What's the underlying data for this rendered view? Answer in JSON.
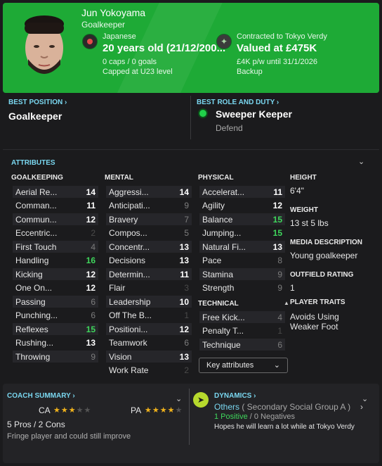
{
  "header": {
    "name": "Jun Yokoyama",
    "position": "Goalkeeper",
    "nationality": "Japanese",
    "age": "20 years old (21/12/200...",
    "caps": "0 caps / 0 goals",
    "capped": "Capped at U23 level",
    "contract": "Contracted to Tokyo Verdy",
    "value": "Valued at £475K",
    "wage": "£4K p/w until 31/1/2026",
    "squad_role": "Backup",
    "accent": "#1eaa36"
  },
  "best_position": {
    "label": "BEST POSITION ›",
    "value": "Goalkeeper"
  },
  "best_role": {
    "label": "BEST ROLE AND DUTY ›",
    "role": "Sweeper Keeper",
    "duty": "Defend"
  },
  "attributes": {
    "title": "ATTRIBUTES",
    "goalkeeping": {
      "heading": "GOALKEEPING",
      "rows": [
        {
          "name": "Aerial Re...",
          "value": "14"
        },
        {
          "name": "Comman...",
          "value": "11"
        },
        {
          "name": "Commun...",
          "value": "12"
        },
        {
          "name": "Eccentric...",
          "value": "2"
        },
        {
          "name": "First Touch",
          "value": "4"
        },
        {
          "name": "Handling",
          "value": "16"
        },
        {
          "name": "Kicking",
          "value": "12"
        },
        {
          "name": "One On...",
          "value": "12"
        },
        {
          "name": "Passing",
          "value": "6"
        },
        {
          "name": "Punching...",
          "value": "6"
        },
        {
          "name": "Reflexes",
          "value": "15"
        },
        {
          "name": "Rushing...",
          "value": "13"
        },
        {
          "name": "Throwing",
          "value": "9"
        }
      ]
    },
    "mental": {
      "heading": "MENTAL",
      "rows": [
        {
          "name": "Aggressi...",
          "value": "14"
        },
        {
          "name": "Anticipati...",
          "value": "9"
        },
        {
          "name": "Bravery",
          "value": "7"
        },
        {
          "name": "Compos...",
          "value": "5"
        },
        {
          "name": "Concentr...",
          "value": "13"
        },
        {
          "name": "Decisions",
          "value": "13"
        },
        {
          "name": "Determin...",
          "value": "11"
        },
        {
          "name": "Flair",
          "value": "3"
        },
        {
          "name": "Leadership",
          "value": "10"
        },
        {
          "name": "Off The B...",
          "value": "1"
        },
        {
          "name": "Positioni...",
          "value": "12"
        },
        {
          "name": "Teamwork",
          "value": "6"
        },
        {
          "name": "Vision",
          "value": "13"
        },
        {
          "name": "Work Rate",
          "value": "2"
        }
      ]
    },
    "physical": {
      "heading": "PHYSICAL",
      "rows": [
        {
          "name": "Accelerat...",
          "value": "11"
        },
        {
          "name": "Agility",
          "value": "12"
        },
        {
          "name": "Balance",
          "value": "15"
        },
        {
          "name": "Jumping...",
          "value": "15"
        },
        {
          "name": "Natural Fi...",
          "value": "13"
        },
        {
          "name": "Pace",
          "value": "8"
        },
        {
          "name": "Stamina",
          "value": "9"
        },
        {
          "name": "Strength",
          "value": "9"
        }
      ]
    },
    "technical": {
      "heading": "TECHNICAL",
      "rows": [
        {
          "name": "Free Kick...",
          "value": "4"
        },
        {
          "name": "Penalty T...",
          "value": "1"
        },
        {
          "name": "Technique",
          "value": "6"
        }
      ]
    },
    "key_button": "Key attributes"
  },
  "info": {
    "height_label": "HEIGHT",
    "height": "6'4\"",
    "weight_label": "WEIGHT",
    "weight": "13 st 5 lbs",
    "media_label": "MEDIA DESCRIPTION",
    "media": "Young goalkeeper",
    "rating_label": "OUTFIELD RATING",
    "rating": "1",
    "traits_label": "PLAYER TRAITS",
    "trait_1": "Avoids Using",
    "trait_2": "Weaker Foot"
  },
  "coach": {
    "title": "COACH SUMMARY ›",
    "ca_label": "CA",
    "pa_label": "PA",
    "ca_stars": 3,
    "pa_stars": 3.5,
    "pros": "5 Pros / 2 Cons",
    "desc": "Fringe player and could still improve"
  },
  "dynamics": {
    "title": "DYNAMICS ›",
    "group_name": "Others",
    "group_detail": " ( Secondary Social Group A )",
    "positive": "1 Positive",
    "negative": " / 0 Negatives",
    "hope": "Hopes he will learn a lot while at Tokyo Verdy"
  }
}
